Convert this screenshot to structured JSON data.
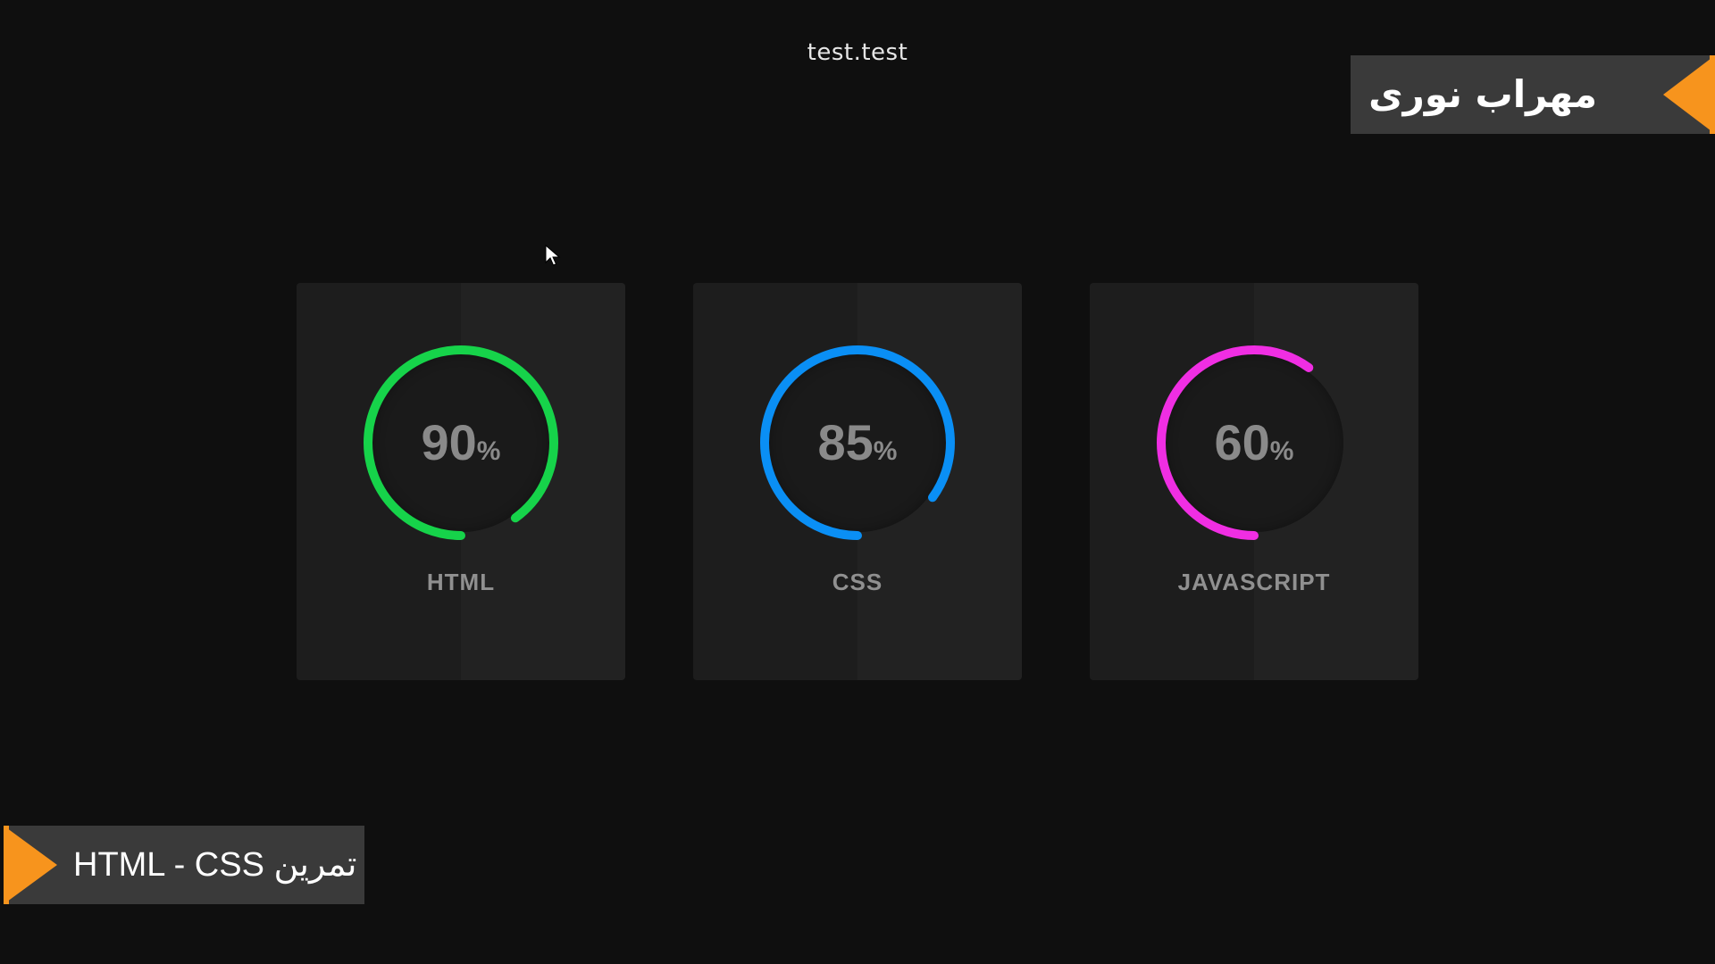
{
  "page": {
    "title": "test.test"
  },
  "author_banner": {
    "text": "مهراب نوری",
    "accent": "#f7941d"
  },
  "course_banner": {
    "text": "تمرین HTML - CSS",
    "accent": "#f7941d"
  },
  "cards": [
    {
      "label": "HTML",
      "value": "90",
      "unit": "%",
      "percent": 90,
      "color": "#16d34a"
    },
    {
      "label": "CSS",
      "value": "85",
      "unit": "%",
      "percent": 85,
      "color": "#0a8ff5"
    },
    {
      "label": "JAVASCRIPT",
      "value": "60",
      "unit": "%",
      "percent": 60,
      "color": "#f02ee3"
    }
  ],
  "colors": {
    "background": "#0f0f0f",
    "card": "#1d1d1d",
    "banner": "#3a3a3a"
  }
}
